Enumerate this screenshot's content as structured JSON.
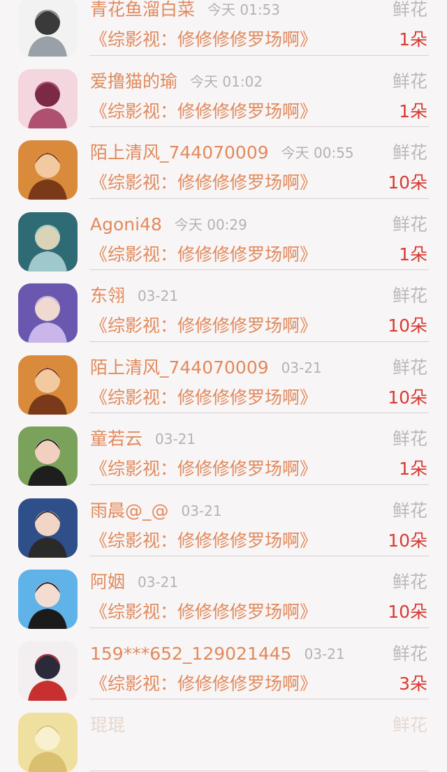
{
  "items": [
    {
      "name": "青花鱼溜白菜",
      "time": "今天 01:53",
      "gift": "鲜花",
      "book": "《综影视：修修修修罗场啊》",
      "count": "1朵",
      "avatar_icon": "avatar-old-man-cartoon-icon",
      "colors": [
        "#f2f2f2",
        "#9aa0a8",
        "#3a3a3a"
      ]
    },
    {
      "name": "爱撸猫的瑜",
      "time": "今天 01:02",
      "gift": "鲜花",
      "book": "《综影视：修修修修罗场啊》",
      "count": "1朵",
      "avatar_icon": "avatar-anime-girl-pink-icon",
      "colors": [
        "#f4d6de",
        "#b05070",
        "#7a2a44"
      ]
    },
    {
      "name": "陌上清风_744070009",
      "time": "今天 00:55",
      "gift": "鲜花",
      "book": "《综影视：修修修修罗场啊》",
      "count": "10朵",
      "avatar_icon": "avatar-cartoon-boy-orange-icon",
      "colors": [
        "#d98a3a",
        "#7a3a1a",
        "#f3c9a0"
      ]
    },
    {
      "name": "Agoni48",
      "time": "今天 00:29",
      "gift": "鲜花",
      "book": "《综影视：修修修修罗场啊》",
      "count": "1朵",
      "avatar_icon": "avatar-rings-teal-icon",
      "colors": [
        "#2f6b75",
        "#9fc8cc",
        "#d9d3b8"
      ]
    },
    {
      "name": "东翎",
      "time": "03-21",
      "gift": "鲜花",
      "book": "《综影视：修修修修罗场啊》",
      "count": "10朵",
      "avatar_icon": "avatar-purple-hair-girl-icon",
      "colors": [
        "#6a58b0",
        "#c9b6ea",
        "#f0d9d0"
      ]
    },
    {
      "name": "陌上清风_744070009",
      "time": "03-21",
      "gift": "鲜花",
      "book": "《综影视：修修修修罗场啊》",
      "count": "10朵",
      "avatar_icon": "avatar-cartoon-boy-orange-icon",
      "colors": [
        "#d98a3a",
        "#7a3a1a",
        "#f3c9a0"
      ]
    },
    {
      "name": "童若云",
      "time": "03-21",
      "gift": "鲜花",
      "book": "《综影视：修修修修罗场啊》",
      "count": "1朵",
      "avatar_icon": "avatar-woman-photo-icon",
      "colors": [
        "#7aa25a",
        "#1e1e1e",
        "#f1d0c0"
      ]
    },
    {
      "name": "雨晨@_@",
      "time": "03-21",
      "gift": "鲜花",
      "book": "《综影视：修修修修罗场啊》",
      "count": "10朵",
      "avatar_icon": "avatar-young-man-photo-icon",
      "colors": [
        "#2f4f8a",
        "#2a2a2a",
        "#f1d6c8"
      ]
    },
    {
      "name": "阿姻",
      "time": "03-21",
      "gift": "鲜花",
      "book": "《综影视：修修修修罗场啊》",
      "count": "10朵",
      "avatar_icon": "avatar-costume-girl-icon",
      "colors": [
        "#5fb3e8",
        "#1b1b1b",
        "#f4dcd2"
      ]
    },
    {
      "name": "159***652_129021445",
      "time": "03-21",
      "gift": "鲜花",
      "book": "《综影视：修修修修罗场啊》",
      "count": "3朵",
      "avatar_icon": "avatar-hanfu-girl-red-icon",
      "colors": [
        "#f3eef0",
        "#c83030",
        "#2a2a3a"
      ]
    },
    {
      "name": "琨琨",
      "time": "",
      "gift": "鲜花",
      "book": "",
      "count": "",
      "avatar_icon": "avatar-yellow-icon",
      "colors": [
        "#f0e0a0",
        "#d9c070",
        "#f8f0d0"
      ]
    }
  ]
}
